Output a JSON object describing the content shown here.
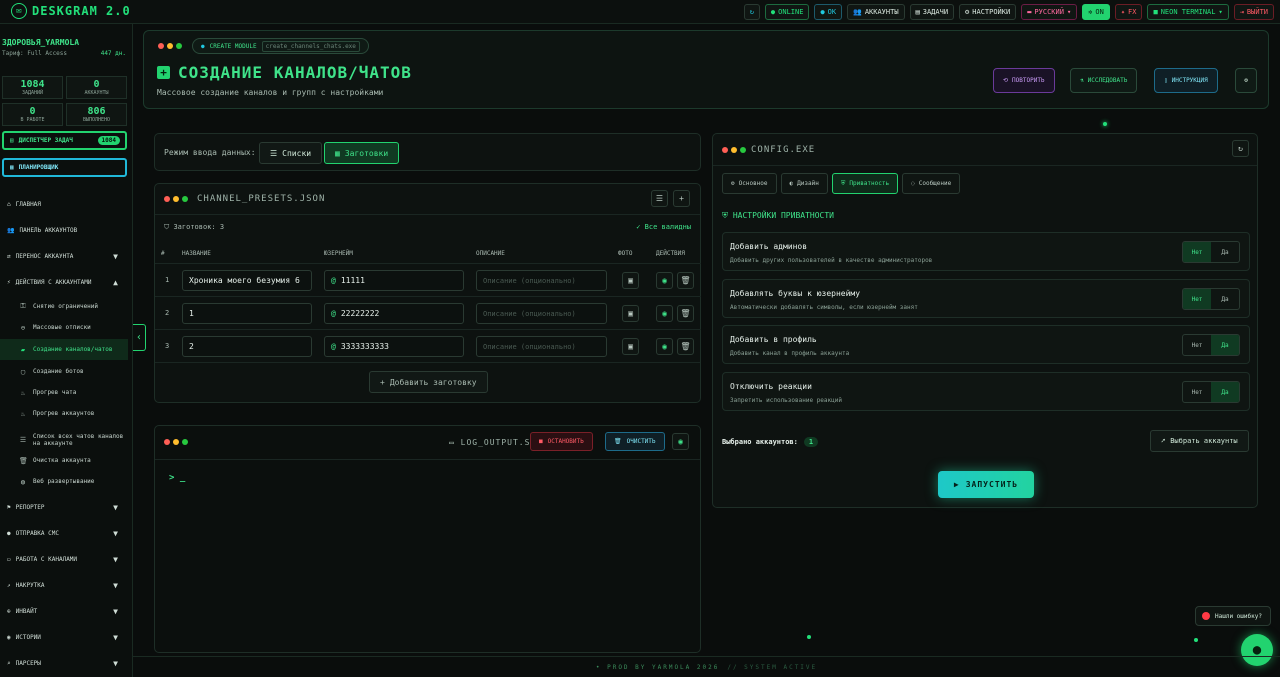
{
  "topbar": {
    "logo": "DESKGRAM 2.0",
    "refresh_icon": "↻",
    "online": "ONLINE",
    "ok": "OK",
    "accounts": "АККАУНТЫ",
    "tasks": "ЗАДАЧИ",
    "settings": "НАСТРОЙКИ",
    "language": "РУССКИЙ",
    "on": "ON",
    "fx": "FX",
    "theme": "NEON TERMINAL",
    "logout": "ВЫЙТИ"
  },
  "sidebar": {
    "username": "ЗДОРОВЬЯ_YARMOLA",
    "plan": "Тариф: Full Access",
    "days": "447 дн.",
    "stats": [
      {
        "value": "1084",
        "label": "ЗАДАНИЙ"
      },
      {
        "value": "0",
        "label": "АККАУНТЫ"
      },
      {
        "value": "0",
        "label": "В РАБОТЕ"
      },
      {
        "value": "806",
        "label": "ВЫПОЛНЕНО"
      }
    ],
    "dispatcher": "ДИСПЕТЧЕР ЗАДАЧ",
    "dispatcher_count": "1084",
    "scheduler": "ПЛАНИРОВЩИК",
    "nav": {
      "home": "ГЛАВНАЯ",
      "accounts_panel": "ПАНЕЛЬ АККАУНТОВ",
      "transfer": "ПЕРЕНОС АККАУНТА",
      "actions": "ДЕЙСТВИЯ С АККАУНТАМИ",
      "reporter": "РЕПОРТЕР",
      "sms": "ОТПРАВКА СМС",
      "channels": "РАБОТА С КАНАЛАМИ",
      "boost": "НАКРУТКА",
      "invite": "ИНВАЙТ",
      "stories": "ИСТОРИИ",
      "parsers": "ПАРСЕРЫ"
    },
    "sub": [
      "Снятие ограничений",
      "Массовые отписки",
      "Создание каналов/чатов",
      "Создание ботов",
      "Прогрев чата",
      "Прогрев аккаунтов",
      "Список всех чатов каналов на аккаунте",
      "Очистка аккаунта",
      "Веб развертывание"
    ]
  },
  "header": {
    "module_tag": "CREATE MODULE",
    "module_file": "create_channels_chats.exe",
    "title": "СОЗДАНИЕ КАНАЛОВ/ЧАТОВ",
    "subtitle": "Массовое создание каналов и групп с настройками",
    "repeat": "ПОВТОРИТЬ",
    "explore": "ИССЛЕДОВАТЬ",
    "instructions": "ИНСТРУКЦИЯ"
  },
  "mode": {
    "label": "Режим ввода данных:",
    "lists": "Списки",
    "presets": "Заготовки"
  },
  "presets": {
    "title": "CHANNEL_PRESETS.JSON",
    "count": "Заготовок: 3",
    "all_valid": "Все валидны",
    "cols": [
      "#",
      "НАЗВАНИЕ",
      "ЮЗЕРНЕЙМ",
      "ОПИСАНИЕ",
      "ФОТО",
      "ДЕЙСТВИЯ"
    ],
    "rows": [
      {
        "n": "1",
        "name": "Хроника моего безумия 6",
        "user": "11111",
        "desc": "Описание (опционально)"
      },
      {
        "n": "2",
        "name": "1",
        "user": "22222222",
        "desc": "Описание (опционально)"
      },
      {
        "n": "3",
        "name": "2",
        "user": "3333333333",
        "desc": "Описание (опционально)"
      }
    ],
    "add": "Добавить заготовку"
  },
  "log": {
    "title": "LOG_OUTPUT.SH",
    "stop": "ОСТАНОВИТЬ",
    "clear": "ОЧИСТИТЬ",
    "prompt": "> _"
  },
  "config": {
    "title": "CONFIG.EXE",
    "tabs": [
      "Основное",
      "Дизайн",
      "Приватность",
      "Сообщение"
    ],
    "section": "НАСТРОЙКИ ПРИВАТНОСТИ",
    "options": [
      {
        "title": "Добавить админов",
        "desc": "Добавить других пользователей в качестве администраторов",
        "no": "Нет",
        "yes": "Да",
        "value": "Нет"
      },
      {
        "title": "Добавлять буквы к юзернейму",
        "desc": "Автоматически добавлять символы, если юзернейм занят",
        "no": "Нет",
        "yes": "Да",
        "value": "Нет"
      },
      {
        "title": "Добавить в профиль",
        "desc": "Добавить канал в профиль аккаунта",
        "no": "Нет",
        "yes": "Да",
        "value": "Да"
      },
      {
        "title": "Отключить реакции",
        "desc": "Запретить использование реакций",
        "no": "Нет",
        "yes": "Да",
        "value": "Да"
      }
    ],
    "selected_label": "Выбрано аккаунтов:",
    "selected_count": "1",
    "select_btn": "Выбрать аккаунты",
    "run": "ЗАПУСТИТЬ"
  },
  "bug": "Нашли ошибку?",
  "footer": {
    "prod": "PROD BY YARMOLA 2026",
    "status": "// SYSTEM ACTIVE"
  },
  "colors": {
    "accent": "#22d36f",
    "cyan": "#20c8e0",
    "bg": "#0a0d0c"
  }
}
